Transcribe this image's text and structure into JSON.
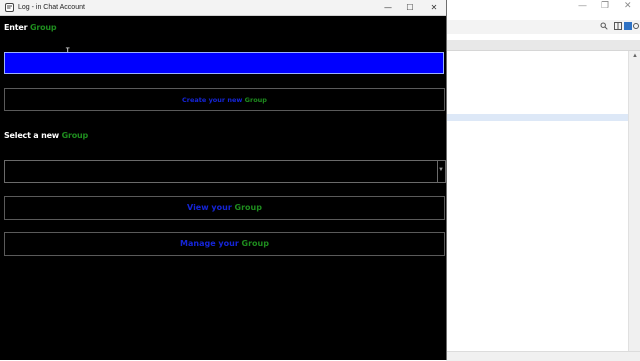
{
  "window": {
    "title": "Log - in Chat Account",
    "minimize": "—",
    "maximize": "☐",
    "close": "✕"
  },
  "enter_group": {
    "prefix": "Enter ",
    "highlight": "Group"
  },
  "group_input": {
    "value": "",
    "placeholder": ""
  },
  "create_button": {
    "prefix": "Create your new ",
    "highlight": "Group"
  },
  "select_group": {
    "prefix": "Select a new ",
    "highlight": "Group"
  },
  "group_select": {
    "selected": ""
  },
  "view_button": {
    "prefix": "View your ",
    "highlight": "Group"
  },
  "manage_button": {
    "prefix": "Manage your ",
    "highlight": "Group"
  },
  "background_window": {
    "minimize": "—",
    "maximize": "❐",
    "close": "✕"
  },
  "colors": {
    "background": "#000000",
    "label_white": "#ffffff",
    "accent_green": "#1e8c1e",
    "button_blue": "#1525d8",
    "input_blue": "#0000ff"
  }
}
